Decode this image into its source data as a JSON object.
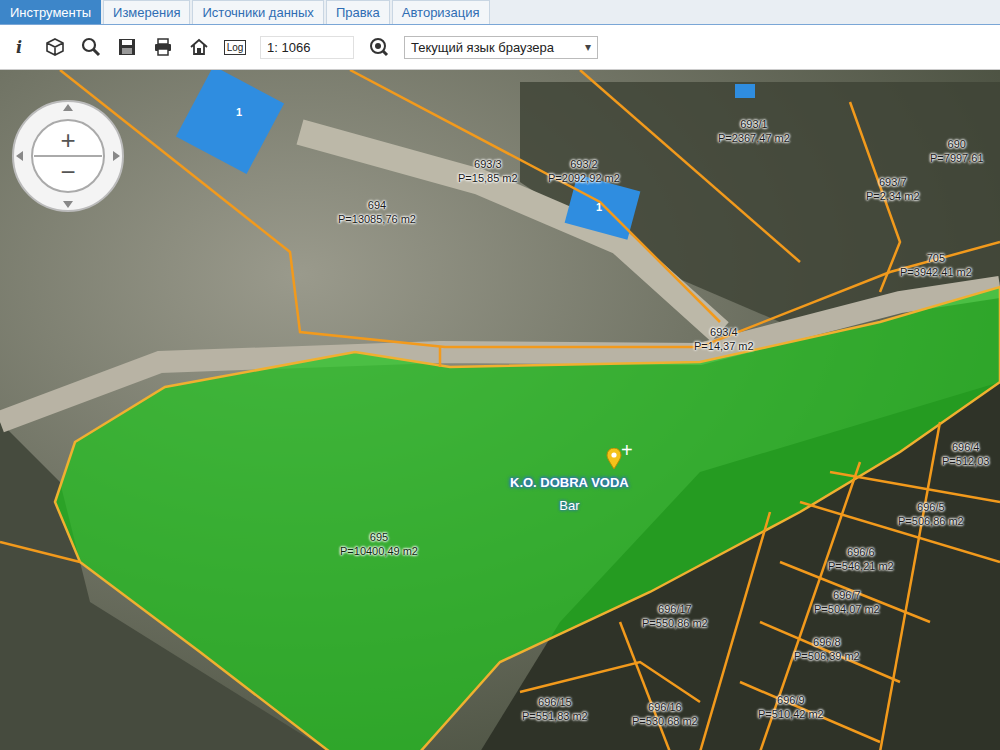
{
  "tabs": [
    {
      "label": "Инструменты",
      "selected": true
    },
    {
      "label": "Измерения",
      "selected": false
    },
    {
      "label": "Источники данных",
      "selected": false
    },
    {
      "label": "Правка",
      "selected": false
    },
    {
      "label": "Авторизация",
      "selected": false
    }
  ],
  "toolbar": {
    "info": "i",
    "log": "Log",
    "scale": "1: 1066",
    "language": "Текущий язык браузера",
    "dropdown_arrow": "▾"
  },
  "map": {
    "zoom_in": "+",
    "zoom_out": "−",
    "crosshair": "+",
    "place": {
      "name": "K.O. DOBRA VODA",
      "type": "Bar"
    },
    "buildings": [
      {
        "label": "1"
      },
      {
        "label": "1"
      }
    ],
    "parcels": [
      {
        "number": "693/3",
        "area": "P=15,85 m2",
        "selected": false
      },
      {
        "number": "693/2",
        "area": "P=2092,92 m2",
        "selected": false
      },
      {
        "number": "693/1",
        "area": "P=2367,47 m2",
        "selected": false
      },
      {
        "number": "690",
        "area": "P=7997,61",
        "selected": false
      },
      {
        "number": "693/7",
        "area": "P=2,34 m2",
        "selected": false
      },
      {
        "number": "694",
        "area": "P=13085,76 m2",
        "selected": false
      },
      {
        "number": "705",
        "area": "P=3942,41 m2",
        "selected": false
      },
      {
        "number": "693/4",
        "area": "P=14,37 m2",
        "selected": false
      },
      {
        "number": "695",
        "area": "P=10400,49 m2",
        "selected": true
      },
      {
        "number": "696/4",
        "area": "P=512,03",
        "selected": false
      },
      {
        "number": "696/5",
        "area": "P=506,86 m2",
        "selected": false
      },
      {
        "number": "696/6",
        "area": "P=546,21 m2",
        "selected": false
      },
      {
        "number": "696/7",
        "area": "P=504,07 m2",
        "selected": false
      },
      {
        "number": "696/8",
        "area": "P=506,39 m2",
        "selected": false
      },
      {
        "number": "696/9",
        "area": "P=510,42 m2",
        "selected": false
      },
      {
        "number": "696/17",
        "area": "P=550,86 m2",
        "selected": false
      },
      {
        "number": "696/15",
        "area": "P=551,83 m2",
        "selected": false
      },
      {
        "number": "696/16",
        "area": "P=530,68 m2",
        "selected": false
      }
    ]
  }
}
